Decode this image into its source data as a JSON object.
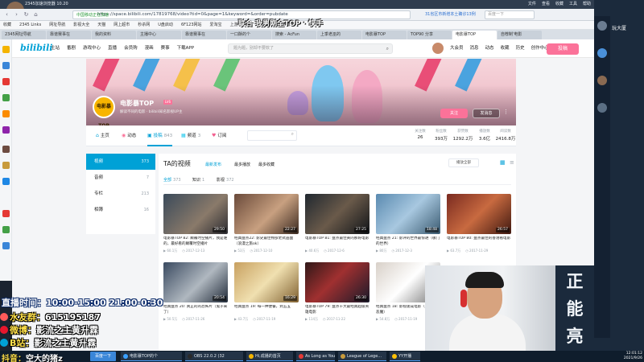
{
  "browser": {
    "title": "2345加速浏览器 10.20",
    "menu": [
      "文件",
      "查看",
      "收藏",
      "工具",
      "帮助"
    ],
    "secure_label": "中国移动正在加速",
    "url": "https://space.bilibili.com/17819768/video?tid=0&page=1&keyword=&order=pubdate",
    "news": "31省区市新增本土确诊13例",
    "search_placeholder": "百度一下"
  },
  "bookmarks": [
    "收藏",
    "2345 Links",
    "网址导航",
    "影视大全",
    "天猫",
    "网上超市",
    "秒杀网",
    "U盘启动",
    "6F123网站",
    "爱淘宝",
    "上游戏导航",
    "一口酥",
    "上师傅"
  ],
  "tabs": [
    {
      "label": "2345网址导航",
      "active": false
    },
    {
      "label": "靠谱赛事在",
      "active": false
    },
    {
      "label": "我的资料",
      "active": false
    },
    {
      "label": "主播中心",
      "active": false
    },
    {
      "label": "靠谱赛事在",
      "active": false
    },
    {
      "label": "一口酥的个",
      "active": false
    },
    {
      "label": "搜索 - AcFun",
      "active": false
    },
    {
      "label": "上季老巫的",
      "active": false
    },
    {
      "label": "电影暴TOP",
      "active": false
    },
    {
      "label": "TOP90 分享",
      "active": false
    },
    {
      "label": "电影暴TOP",
      "active": true
    },
    {
      "label": "自荐制'电影",
      "active": false
    }
  ],
  "right_panel": {
    "title": "玩大厦"
  },
  "topnav": {
    "logo": "bilibili",
    "links": [
      "主站",
      "番剧",
      "游戏中心",
      "直播",
      "会员购",
      "漫画",
      "赛事",
      "下载APP"
    ],
    "search_placeholder": "题为题，别却不要软了",
    "user_links": [
      "大会员",
      "消息",
      "动态",
      "收藏",
      "历史",
      "创作中心"
    ],
    "upload_label": "投稿"
  },
  "channel": {
    "avatar_text": "电影暴TOP",
    "name": "电影暴TOP",
    "level": "LV6",
    "sign": "解读不同的电影 · bilibili知名影视UP主",
    "follow_label": "关注",
    "message_label": "发消息",
    "more_label": "⋮"
  },
  "channel_tabs": [
    {
      "icon": "home-icon",
      "label": "主页",
      "count": "",
      "active": false
    },
    {
      "icon": "activity-icon",
      "label": "动态",
      "count": "",
      "active": false
    },
    {
      "icon": "video-icon",
      "label": "投稿",
      "count": "843",
      "active": true
    },
    {
      "icon": "collection-icon",
      "label": "频道",
      "count": "3",
      "active": false
    },
    {
      "icon": "heart-icon",
      "label": "订阅",
      "count": "",
      "active": false
    }
  ],
  "stats": [
    {
      "label": "关注数",
      "value": "26"
    },
    {
      "label": "粉丝数",
      "value": "393万"
    },
    {
      "label": "获赞数",
      "value": "1292.2万"
    },
    {
      "label": "播放数",
      "value": "3.6亿"
    },
    {
      "label": "阅读数",
      "value": "2416.8万"
    }
  ],
  "side_menu": [
    {
      "label": "视频",
      "count": "373",
      "active": true
    },
    {
      "label": "音频",
      "count": "7",
      "active": false
    },
    {
      "label": "专栏",
      "count": "213",
      "active": false
    },
    {
      "label": "相簿",
      "count": "16",
      "active": false
    }
  ],
  "video_section": {
    "title": "TA的视频",
    "sorts": [
      {
        "label": "最新发布",
        "active": true
      },
      {
        "label": "最多播放",
        "active": false
      },
      {
        "label": "最多收藏",
        "active": false
      }
    ],
    "play_all": "播放全部",
    "filters": [
      {
        "label": "全部",
        "count": "373",
        "active": true
      },
      {
        "label": "知识",
        "count": "1",
        "active": false
      },
      {
        "label": "影视",
        "count": "372",
        "active": false
      }
    ]
  },
  "videos": [
    {
      "title": "电影暴TOP 82: 颠覆时空播片，我是谁的，最好看的颠覆时空播片",
      "views": "60.1万",
      "date": "2017-12-13",
      "duration": "29:50"
    },
    {
      "title": "经典盘点22: 影史最佳物欲老式画面（浪漫之旅ok）",
      "views": "53万",
      "date": "2017-12-10",
      "duration": "22:27"
    },
    {
      "title": "电影暴TOP 81: 盘点最佳黄的那好电影",
      "views": "40.6万",
      "date": "2017-12-6",
      "duration": "27:25"
    },
    {
      "title": "经典盘点 21: 影评的世界最惊艳（敬门的世界）",
      "views": "80万",
      "date": "2017-12-3",
      "duration": "18:48"
    },
    {
      "title": "电影暴TOP 80: 盘点最佳的香港看电影",
      "views": "63.7万",
      "date": "2017-11-29",
      "duration": "26:57"
    },
    {
      "title": "经典盘点 20: 真正的的恐怖片（鬼子来了）",
      "views": "50.5万",
      "date": "2017-11-26",
      "duration": "20:54"
    },
    {
      "title": "经典盘点 19: 每一种便餐，到五五",
      "views": "43.7万",
      "date": "2017-11-19",
      "duration": "16:29"
    },
    {
      "title": "电影暴TOP 79: 盘点十大最经典超级英雄电影",
      "views": "114万",
      "date": "2017-11-22",
      "duration": "26:30"
    },
    {
      "title": "经典盘点 18: 影视速成电影（Prada的恶魔）",
      "views": "54.8万",
      "date": "2017-11-19",
      "duration": "22:19"
    }
  ],
  "overlay": {
    "top_text": "联合 我男刚全TOP · 快手",
    "live_time": "直播时间：10:00-15:00 21:00-0:30",
    "fan_rows": [
      {
        "icon": "qq-icon",
        "label": "水友群：",
        "value": "615195187"
      },
      {
        "icon": "weibo-icon",
        "label": "微博：",
        "value": "影流之主黄升霖"
      },
      {
        "icon": "bilibili-icon",
        "label": "B站：",
        "value": "影流之主黄升霖"
      }
    ],
    "tiktok_label": "抖音：",
    "tiktok_value": "空大的猪z",
    "big_text": [
      "正",
      "能",
      "亮"
    ]
  },
  "taskbar": {
    "start": "百度一下",
    "apps": [
      {
        "label": "电影暴TOP的个",
        "color": "#3aa0ff"
      },
      {
        "label": "OBS 22.0.2 (32",
        "color": "#2a2a2a"
      },
      {
        "label": "Hi,成播的首页",
        "color": "#f4b400"
      },
      {
        "label": "As Long as You...",
        "color": "#e53935"
      },
      {
        "label": "League of Lege...",
        "color": "#c89b3c"
      },
      {
        "label": "YY开播",
        "color": "#ffc107"
      }
    ],
    "time": "12:01:12",
    "date": "2021/9/26"
  }
}
